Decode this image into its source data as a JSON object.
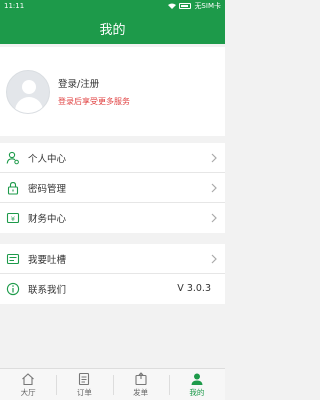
{
  "status_bar": {
    "time": "11:11",
    "carrier": "无SIM卡"
  },
  "header": {
    "title": "我的"
  },
  "profile": {
    "login_label": "登录/注册",
    "hint": "登录后享受更多服务"
  },
  "menu": {
    "personal_center": "个人中心",
    "password_manage": "密码管理",
    "finance_center": "财务中心",
    "feedback": "我要吐槽",
    "contact_us": "联系我们",
    "version": "V 3.0.3"
  },
  "tabs": {
    "hall": "大厅",
    "orders": "订单",
    "send_order": "发单",
    "mine": "我的"
  },
  "colors": {
    "accent": "#1d9a4a",
    "hint": "#e04040"
  }
}
